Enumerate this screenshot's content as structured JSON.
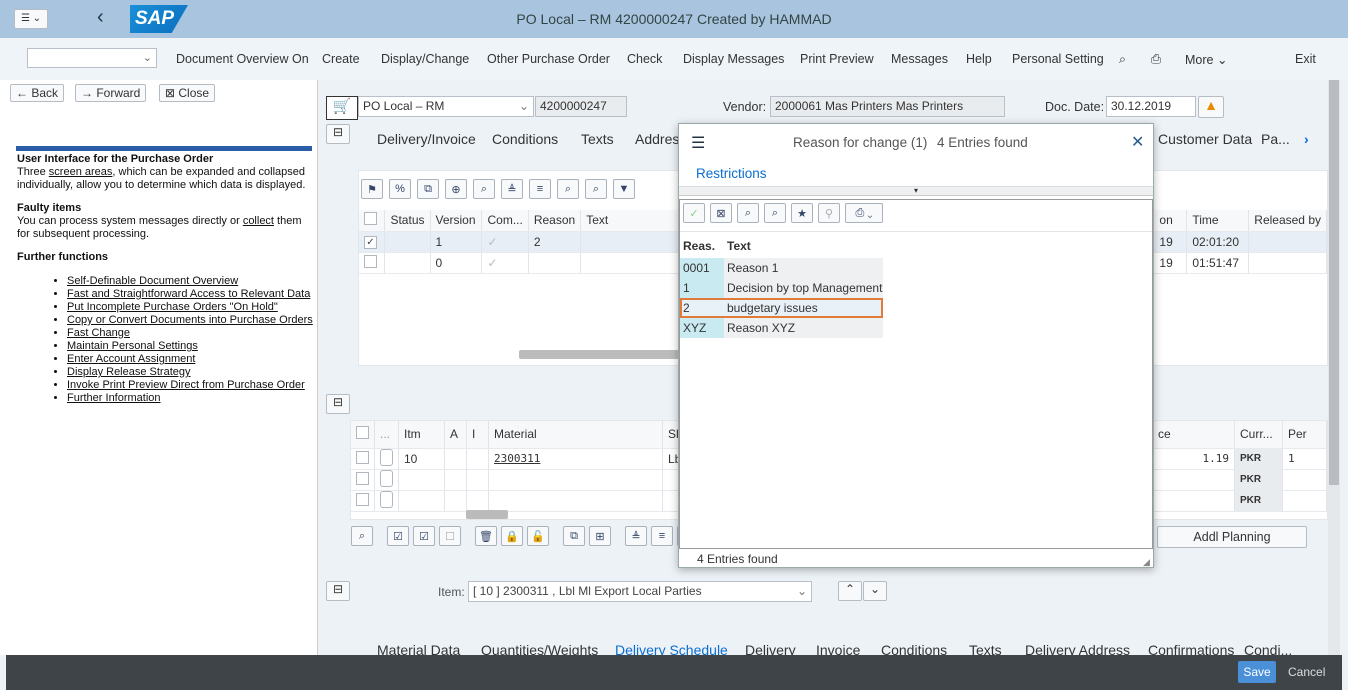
{
  "window": {
    "title": "PO Local – RM 4200000247 Created by HAMMAD",
    "logo": "SAP"
  },
  "menu": {
    "items": [
      "Document Overview On",
      "Create",
      "Display/Change",
      "Other Purchase Order",
      "Check",
      "Display Messages",
      "Print Preview",
      "Messages",
      "Help",
      "Personal Setting"
    ],
    "more": "More",
    "exit": "Exit"
  },
  "nav": {
    "back": "Back",
    "forward": "Forward",
    "close": "Close"
  },
  "help": {
    "title": "User Interface for the Purchase Order",
    "p1a": "Three ",
    "p1link": "screen areas",
    "p1b": ", which can be expanded and collapsed individually, allow you to determine which data is displayed.",
    "h2": "Faulty items",
    "p2a": "You can process system messages directly or ",
    "p2link": "collect",
    "p2b": " them for subsequent processing.",
    "h3": "Further functions",
    "links": [
      "Self-Definable Document Overview",
      "Fast and Straightforward Access to Relevant Data",
      "Put Incomplete Purchase Orders \"On Hold\"",
      "Copy or Convert Documents into Purchase Orders",
      "Fast Change",
      "Maintain Personal Settings",
      "Enter Account Assignment",
      "Display Release Strategy",
      "Invoke Print Preview Direct from Purchase Order",
      "Further Information"
    ]
  },
  "header": {
    "doc_type": "PO Local – RM",
    "po_number": "4200000247",
    "vendor_label": "Vendor:",
    "vendor": "2000061 Mas Printers Mas Printers",
    "doc_date_label": "Doc. Date:",
    "doc_date": "30.12.2019"
  },
  "header_tabs": [
    "Delivery/Invoice",
    "Conditions",
    "Texts",
    "Addres",
    "Customer Data",
    "Pa..."
  ],
  "versions": {
    "columns": [
      "Status",
      "Version",
      "Com...",
      "Reason",
      "Text"
    ],
    "right_columns": [
      "on",
      "Time",
      "Released by"
    ],
    "rows": [
      {
        "checked": true,
        "version": "1",
        "reason": "2",
        "date": "19",
        "time": "02:01:20"
      },
      {
        "checked": false,
        "version": "0",
        "reason": "",
        "date": "19",
        "time": "01:51:47"
      }
    ]
  },
  "items": {
    "columns": [
      "...",
      "Itm",
      "A",
      "I",
      "Material",
      "Sh",
      "ce",
      "Curr...",
      "Per"
    ],
    "rows": [
      {
        "itm": "10",
        "material": "2300311",
        "short": "Lbl",
        "price": "1.19",
        "curr": "PKR",
        "per": "1"
      },
      {
        "itm": "",
        "material": "",
        "short": "",
        "price": "",
        "curr": "PKR",
        "per": ""
      },
      {
        "itm": "",
        "material": "",
        "short": "",
        "price": "",
        "curr": "PKR",
        "per": ""
      }
    ],
    "addl_planning": "Addl Planning"
  },
  "item_detail": {
    "label": "Item:",
    "value": "[ 10 ] 2300311 , Lbl Ml Export Local Parties"
  },
  "item_tabs": [
    "Material Data",
    "Quantities/Weights",
    "Delivery Schedule",
    "Delivery",
    "Invoice",
    "Conditions",
    "Texts",
    "Delivery Address",
    "Confirmations",
    "Condi..."
  ],
  "popup": {
    "title": "Reason for change (1)",
    "count": "4 Entries found",
    "restrictions": "Restrictions",
    "columns": [
      "Reas.",
      "Text"
    ],
    "rows": [
      {
        "code": "0001",
        "text": "Reason 1"
      },
      {
        "code": "1",
        "text": "Decision by top Management"
      },
      {
        "code": "2",
        "text": "budgetary issues",
        "highlighted": true
      },
      {
        "code": "XYZ",
        "text": "Reason XYZ"
      }
    ],
    "status": "4 Entries found"
  },
  "footer": {
    "save": "Save",
    "cancel": "Cancel"
  },
  "colors": {
    "accent": "#0a6ed1",
    "highlight": "#e07b39",
    "title_bar": "#a8c4de",
    "code_column": "#c8eaf0"
  }
}
